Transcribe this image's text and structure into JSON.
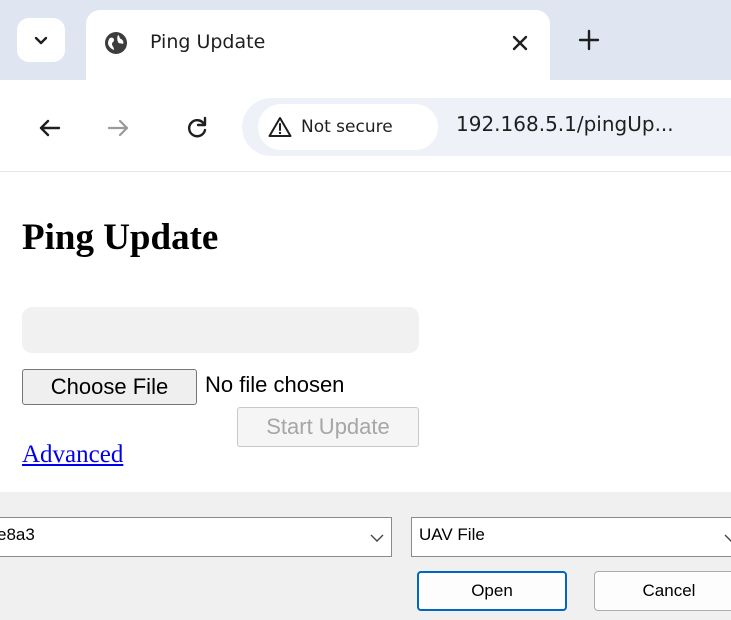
{
  "browser": {
    "tab": {
      "title": "Ping Update",
      "favicon": "globe-icon"
    },
    "toolbar": {
      "security_label": "Not secure",
      "url": "192.168.5.1/pingUp..."
    }
  },
  "page": {
    "title": "Ping Update",
    "progress": 0,
    "choose_file_label": "Choose File",
    "no_file_text": "No file chosen",
    "start_update_label": "Start Update",
    "advanced_link": "Advanced"
  },
  "file_dialog": {
    "file_name_value": "e8a3",
    "file_type_selected": "UAV File",
    "open_label": "Open",
    "cancel_label": "Cancel"
  },
  "colors": {
    "tabstrip": "#dfe6f2",
    "omnibox": "#eef2f8",
    "link": "#0000ee",
    "dialog_primary_border": "#0067c0"
  }
}
